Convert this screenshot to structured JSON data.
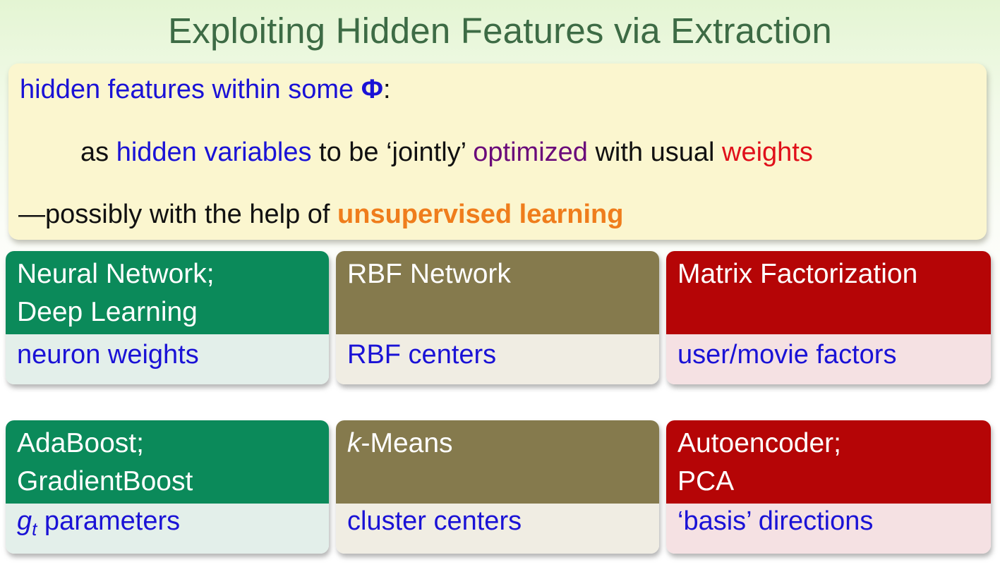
{
  "slide": {
    "title": "Exploiting Hidden Features via Extraction"
  },
  "note": {
    "line1_a": "hidden features within some ",
    "line1_phi": "Φ",
    "line1_colon": ":",
    "line2_as": "as ",
    "line2_hidden_variables": "hidden variables",
    "line2_to_be": " to be ‘jointly’ ",
    "line2_optimized": "optimized",
    "line2_with_usual": " with usual ",
    "line2_weights": "weights",
    "line3_prefix": "—possibly with the help of ",
    "line3_unsupervised": "unsupervised learning"
  },
  "cards": {
    "neural": {
      "title1": "Neural Network;",
      "title2": "Deep Learning",
      "feature": "neuron weights"
    },
    "rbf": {
      "title1": "RBF Network",
      "feature": "RBF centers"
    },
    "matrix": {
      "title1": "Matrix Factorization",
      "feature": "user/movie factors"
    },
    "adaboost": {
      "title1": "AdaBoost;",
      "title2": "GradientBoost",
      "feature_g": "g",
      "feature_sub": "t",
      "feature_rest": " parameters"
    },
    "kmeans": {
      "title_k": "k",
      "title_rest": "-Means",
      "feature": "cluster centers"
    },
    "autoencoder": {
      "title1": "Autoencoder;",
      "title2": "PCA",
      "feature": "‘basis’ directions"
    }
  },
  "colors": {
    "title": "#3d6b45",
    "note_background": "#fbf6cf",
    "emphasis_blue": "#1a12d6",
    "emphasis_purple": "#6a0a7a",
    "emphasis_red": "#e0101a",
    "emphasis_orange": "#ef7d1c",
    "card_green": "#0b8a5a",
    "card_olive": "#857a4d",
    "card_crimson": "#b50506"
  }
}
